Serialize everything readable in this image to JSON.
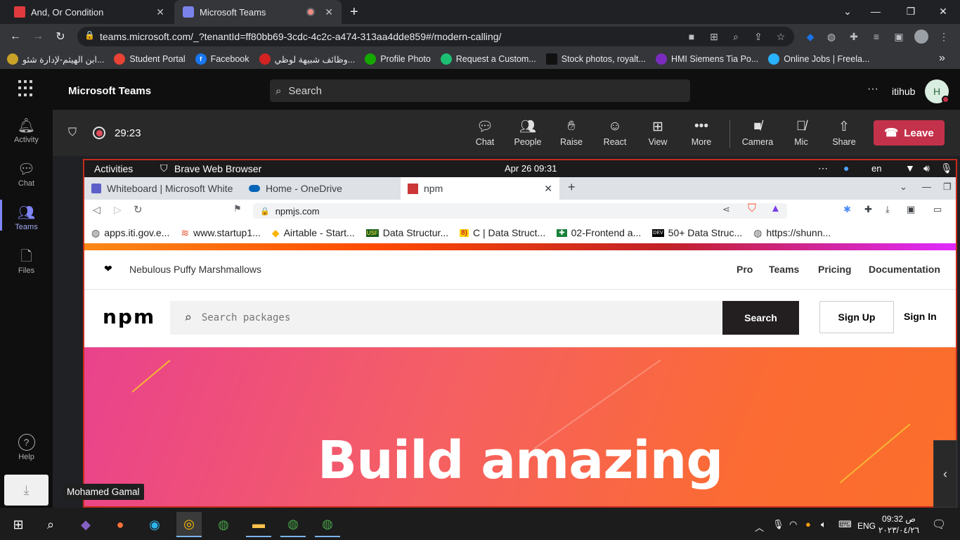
{
  "chrome": {
    "tabs": [
      {
        "title": "And, Or Condition",
        "icon_color": "#e03a3e"
      },
      {
        "title": "Microsoft Teams",
        "icon_color": "#7b83eb"
      }
    ],
    "new_tab": "+",
    "url": "teams.microsoft.com/_?tenantId=ff80bb69-3cdc-4c2c-a474-313aa4dde859#/modern-calling/",
    "bookmarks": [
      {
        "label": "ابن الهيثم-لإدارة شئو...",
        "icon_color": "#c9a227"
      },
      {
        "label": "Student Portal",
        "icon_color": "#ea4335"
      },
      {
        "label": "Facebook",
        "icon_color": "#1877f2"
      },
      {
        "label": "وظائف شبيهة لوظي...",
        "icon_color": "#d32323"
      },
      {
        "label": "Profile Photo",
        "icon_color": "#14a800"
      },
      {
        "label": "Request a Custom...",
        "icon_color": "#1dbf73"
      },
      {
        "label": "Stock photos, royalt...",
        "icon_color": "#111111"
      },
      {
        "label": "HMI Siemens Tia Po...",
        "icon_color": "#7b2cbf"
      },
      {
        "label": "Online Jobs | Freela...",
        "icon_color": "#29b2fe"
      }
    ],
    "more_bookmarks": "»"
  },
  "teams": {
    "app_title": "Microsoft Teams",
    "search_placeholder": "Search",
    "more": "···",
    "org_name": "itihub",
    "avatar_initial": "H",
    "rail": [
      {
        "label": "Activity",
        "icon": "bell-icon"
      },
      {
        "label": "Chat",
        "icon": "chat-icon"
      },
      {
        "label": "Teams",
        "icon": "teams-icon"
      },
      {
        "label": "Files",
        "icon": "files-icon"
      }
    ],
    "help": "Help",
    "call": {
      "timer": "29:23",
      "buttons": [
        {
          "label": "Chat",
          "icon": "chat-bubble-icon"
        },
        {
          "label": "People",
          "icon": "people-icon"
        },
        {
          "label": "Raise",
          "icon": "hand-icon"
        },
        {
          "label": "React",
          "icon": "smiley-icon"
        },
        {
          "label": "View",
          "icon": "grid-icon"
        },
        {
          "label": "More",
          "icon": "more-icon"
        },
        {
          "label": "Camera",
          "icon": "camera-off-icon"
        },
        {
          "label": "Mic",
          "icon": "mic-off-icon"
        },
        {
          "label": "Share",
          "icon": "share-icon"
        }
      ],
      "leave": "Leave"
    },
    "presenter_name": "Mohamed Gamal"
  },
  "shared_screen": {
    "topbar": {
      "activities": "Activities",
      "app": "Brave Web Browser",
      "clock": "Apr 26  09:31",
      "lang": "en"
    },
    "tabs": [
      {
        "title": "Whiteboard | Microsoft White"
      },
      {
        "title": "Home - OneDrive"
      },
      {
        "title": "npm"
      }
    ],
    "url": "npmjs.com",
    "bookmarks": [
      "apps.iti.gov.e...",
      "www.startup1...",
      "Airtable - Start...",
      "Data Structur...",
      "C | Data Struct...",
      "02-Frontend a...",
      "50+ Data Struc...",
      "https://shunn..."
    ],
    "npm": {
      "tagline": "Nebulous Puffy Marshmallows",
      "nav": [
        "Pro",
        "Teams",
        "Pricing",
        "Documentation"
      ],
      "logo": "npm",
      "search_placeholder": "Search packages",
      "search_button": "Search",
      "sign_up": "Sign Up",
      "sign_in": "Sign In",
      "hero_title": "Build amazing"
    }
  },
  "taskbar": {
    "time": "09:32 ص",
    "date": "٢٠٢٣/٠٤/٢٦",
    "lang": "ENG"
  }
}
